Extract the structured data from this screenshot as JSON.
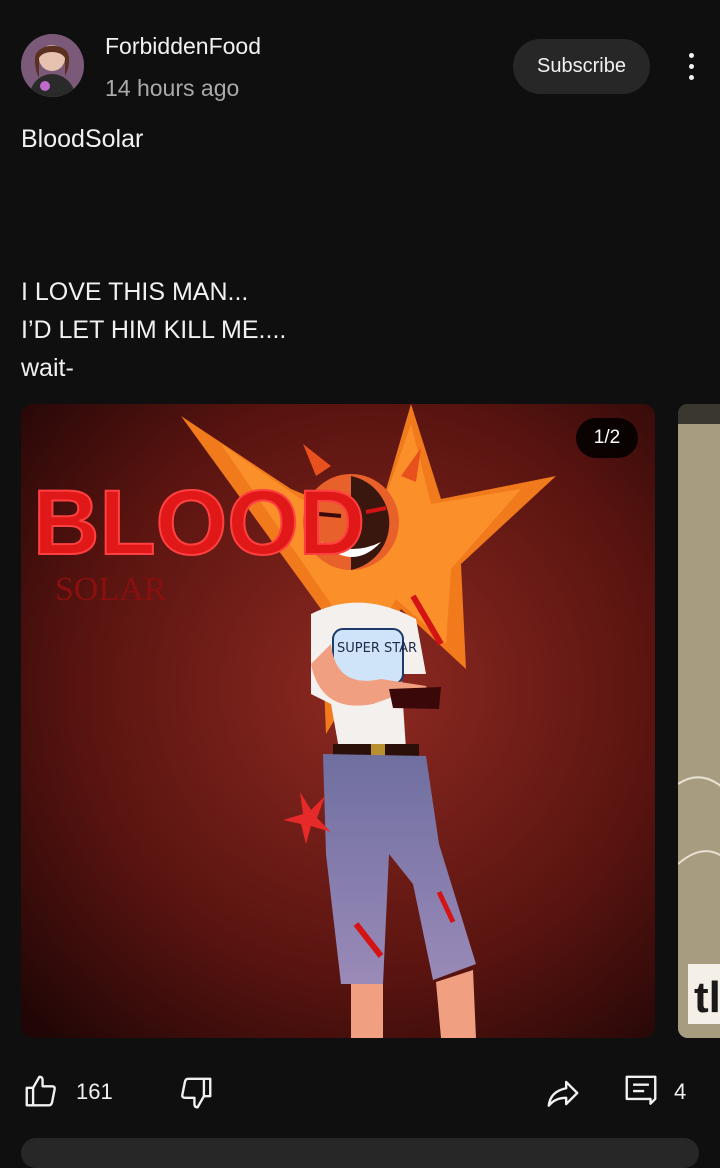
{
  "post": {
    "channel": "ForbiddenFood",
    "time": "14 hours ago",
    "subscribe_label": "Subscribe",
    "text_lines": [
      "BloodSolar",
      "I LOVE THIS MAN...",
      "I’D LET HIM KILL ME....",
      "wait-"
    ]
  },
  "carousel": {
    "counter": "1/2",
    "art_title": "BLOOD",
    "art_subtitle": "SOLAR",
    "shirt_text": "SUPER STAR",
    "next_slide_partial_text": "tl"
  },
  "actions": {
    "like_count": "161",
    "comment_count": "4"
  },
  "icons": {
    "like": "thumbs-up-icon",
    "dislike": "thumbs-down-icon",
    "share": "share-icon",
    "comment": "comment-icon",
    "more": "more-vertical-icon"
  },
  "colors": {
    "background": "#0f0f0f",
    "button_bg": "#272727",
    "text_primary": "#f1f1f1",
    "text_secondary": "#aaaaaa",
    "art_red": "#d41414"
  }
}
